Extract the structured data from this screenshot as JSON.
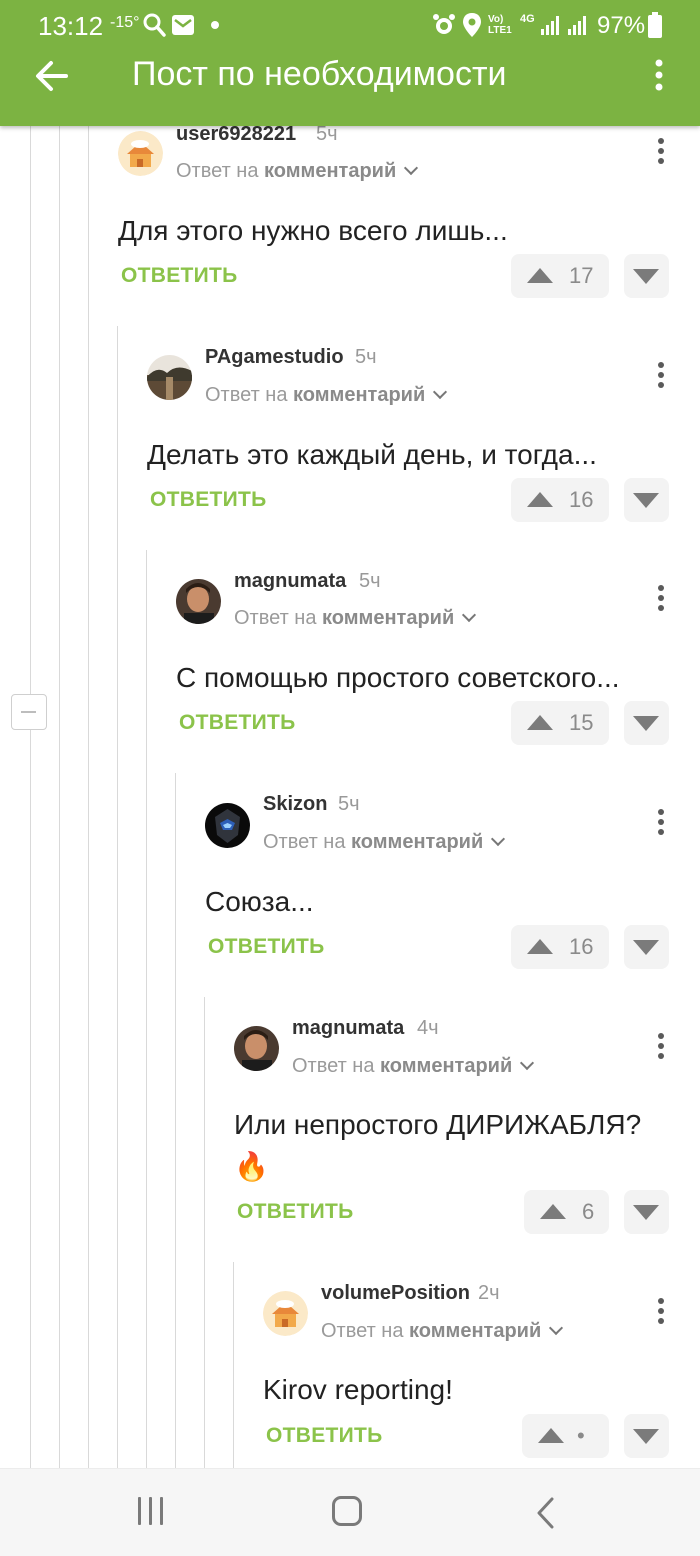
{
  "status_bar": {
    "time": "13:12",
    "temperature": "-15°",
    "network": "Vo) LTE1",
    "network_type": "4G",
    "battery": "97%"
  },
  "app_bar": {
    "title": "Пост по необходимости",
    "back_icon": "arrow-left-icon",
    "menu_icon": "more-vertical-icon"
  },
  "reply_label": "ОТВЕТИТЬ",
  "reply_to_prefix": "Ответ на",
  "reply_to_target": "комментарий",
  "comments": [
    {
      "username": "user6928221",
      "time": "5ч",
      "text": "Для этого нужно всего лишь...",
      "rating": "17",
      "avatar": "house-avatar"
    },
    {
      "username": "PAgamestudio",
      "time": "5ч",
      "text": "Делать это каждый день, и тогда...",
      "rating": "16",
      "avatar": "landscape-avatar"
    },
    {
      "username": "magnumata",
      "time": "5ч",
      "text": "С помощью простого советского...",
      "rating": "15",
      "avatar": "portrait-avatar"
    },
    {
      "username": "Skizon",
      "time": "5ч",
      "text": "Союза...",
      "rating": "16",
      "avatar": "helmet-avatar"
    },
    {
      "username": "magnumata",
      "time": "4ч",
      "text": "Или непростого ДИРИЖАБЛЯ?",
      "emoji": "🔥",
      "rating": "6",
      "avatar": "portrait-avatar"
    },
    {
      "username": "volumePosition",
      "time": "2ч",
      "text": "Kirov reporting!",
      "rating": "•",
      "avatar": "house-avatar"
    }
  ],
  "colors": {
    "accent_green": "#7cb342",
    "reply_green": "#8bc34a"
  }
}
